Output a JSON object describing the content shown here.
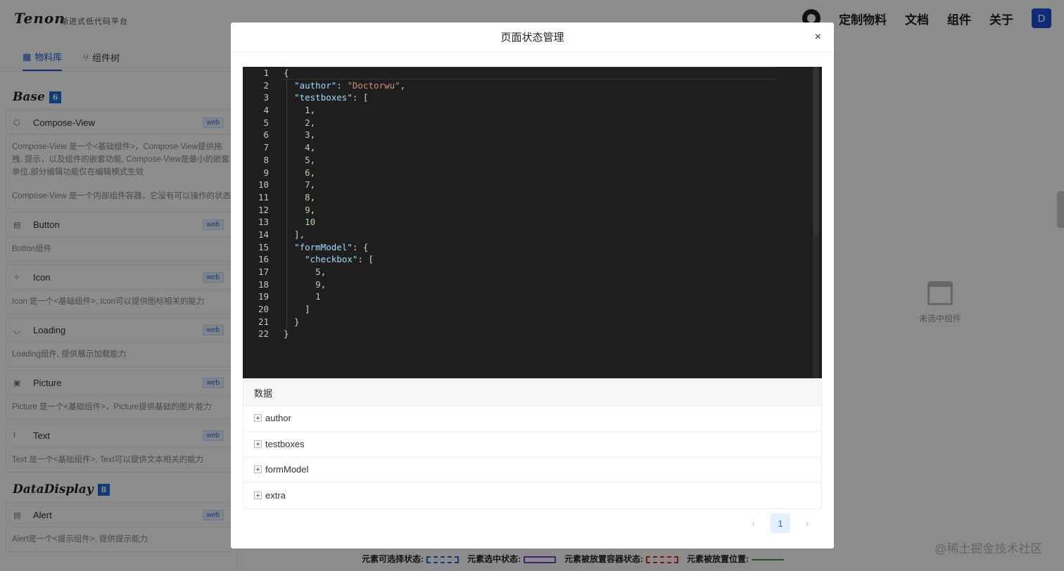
{
  "app": {
    "logo": "Tenon",
    "logo_sub": "渐进式低代码平台",
    "nav": [
      "定制物料",
      "文档",
      "组件",
      "关于"
    ],
    "avatar": "D"
  },
  "sidebar": {
    "tabs": [
      {
        "label": "物料库",
        "icon": "grid-icon"
      },
      {
        "label": "组件树",
        "icon": "branch-icon"
      }
    ],
    "groups": [
      {
        "title": "Base",
        "count": "6"
      },
      {
        "title": "DataDisplay",
        "count": "8"
      }
    ],
    "cards": [
      {
        "name": "Compose-View",
        "tag": "web",
        "icon": "cube-icon",
        "desc": [
          "Compose-View 是一个<基础组件>，Compose-View提供拖",
          "拽, 提示，以及组件的嵌套功能, Compose-View是最小的嵌套",
          "单位,部分编辑功能仅在编辑模式生效"
        ],
        "desc2": "Compose-View 是一个内部组件容器，它没有可以操作的状态"
      },
      {
        "name": "Button",
        "tag": "web",
        "icon": "doc-icon",
        "desc": [
          "Button组件"
        ]
      },
      {
        "name": "Icon",
        "tag": "web",
        "icon": "star-icon",
        "desc": [
          "Icon 是一个<基础组件>, Icon可以提供图标相关的能力"
        ]
      },
      {
        "name": "Loading",
        "tag": "web",
        "icon": "loading-icon",
        "desc": [
          "Loading组件, 提供展示加载能力"
        ]
      },
      {
        "name": "Picture",
        "tag": "web",
        "icon": "picture-icon",
        "desc": [
          "Picture 是一个<基础组件>，Picture提供基础的图片能力"
        ]
      },
      {
        "name": "Text",
        "tag": "web",
        "icon": "text-icon",
        "desc": [
          "Text 是一个<基础组件>, Text可以提供文本相关的能力"
        ]
      },
      {
        "name": "Alert",
        "tag": "web",
        "icon": "doc-icon",
        "desc": [
          "Alert是一个<提示组件>, 提供提示能力"
        ]
      }
    ]
  },
  "empty_state": {
    "label": "未选中组件"
  },
  "legend": [
    {
      "label": "元素可选择状态:",
      "color": "#1f6fd8",
      "style": "dashed"
    },
    {
      "label": "元素选中状态:",
      "color": "#7b3fd8",
      "style": "solid"
    },
    {
      "label": "元素被放置容器状态:",
      "color": "#e03030",
      "style": "dashed"
    },
    {
      "label": "元素被放置位置:",
      "color": "#2aa84a",
      "style": "line"
    }
  ],
  "watermark": "@稀土掘金技术社区",
  "modal": {
    "title": "页面状态管理",
    "close": "×",
    "code_lines": [
      "{",
      "  \"author\": \"Doctorwu\",",
      "  \"testboxes\": [",
      "    1,",
      "    2,",
      "    3,",
      "    4,",
      "    5,",
      "    6,",
      "    7,",
      "    8,",
      "    9,",
      "    10",
      "  ],",
      "  \"formModel\": {",
      "    \"checkbox\": [",
      "      5,",
      "      9,",
      "      1",
      "    ]",
      "  }",
      "}"
    ],
    "table": {
      "header": "数据",
      "rows": [
        "author",
        "testboxes",
        "formModel",
        "extra"
      ]
    },
    "pagination": {
      "prev": "‹",
      "current": "1",
      "next": "›"
    }
  }
}
